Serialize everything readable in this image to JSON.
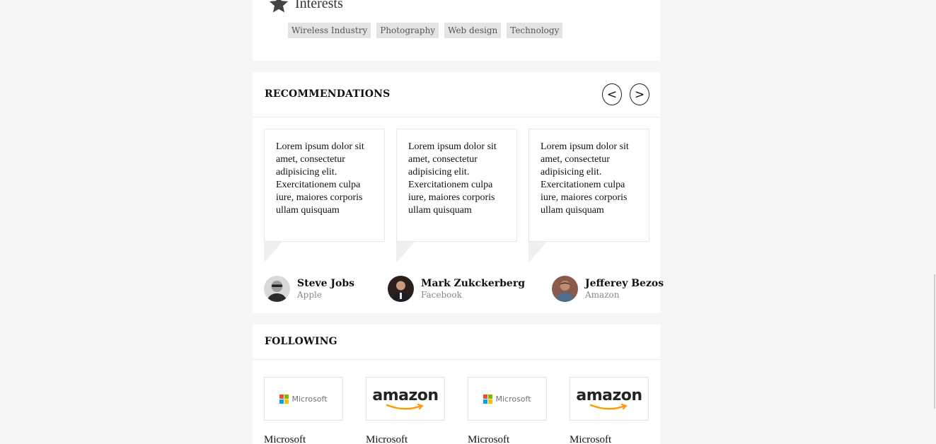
{
  "interests": {
    "title": "Interests",
    "icon": "star-icon",
    "tags": [
      "Wireless Industry",
      "Photography",
      "Web design",
      "Technology"
    ]
  },
  "recommendations": {
    "title": "RECOMMENDATIONS",
    "prev_label": "<",
    "next_label": ">",
    "items": [
      {
        "quote": "Lorem ipsum dolor sit amet, consectetur adipisicing elit. Exercitationem culpa iure, maiores corporis ullam quisquam",
        "name": "Steve Jobs",
        "company": "Apple"
      },
      {
        "quote": "Lorem ipsum dolor sit amet, consectetur adipisicing elit. Exercitationem culpa iure, maiores corporis ullam quisquam",
        "name": "Mark Zukckerberg",
        "company": "Facebook"
      },
      {
        "quote": "Lorem ipsum dolor sit amet, consectetur adipisicing elit. Exercitationem culpa iure, maiores corporis ullam quisquam",
        "name": "Jefferey Bezos",
        "company": "Amazon"
      }
    ]
  },
  "following": {
    "title": "FOLLOWING",
    "items": [
      {
        "logo_text": "Microsoft",
        "name": "Microsoft"
      },
      {
        "logo_text": "amazon",
        "name": "Microsoft"
      },
      {
        "logo_text": "Microsoft",
        "name": "Microsoft"
      },
      {
        "logo_text": "amazon",
        "name": "Microsoft"
      }
    ]
  },
  "colors": {
    "page_bg": "#f5f6f8",
    "card_bg": "#ffffff",
    "tag_bg": "#e4e4e4",
    "ms_red": "#f25022",
    "ms_green": "#7fba00",
    "ms_blue": "#00a4ef",
    "ms_yellow": "#ffb900",
    "amazon_orange": "#ff9900"
  }
}
